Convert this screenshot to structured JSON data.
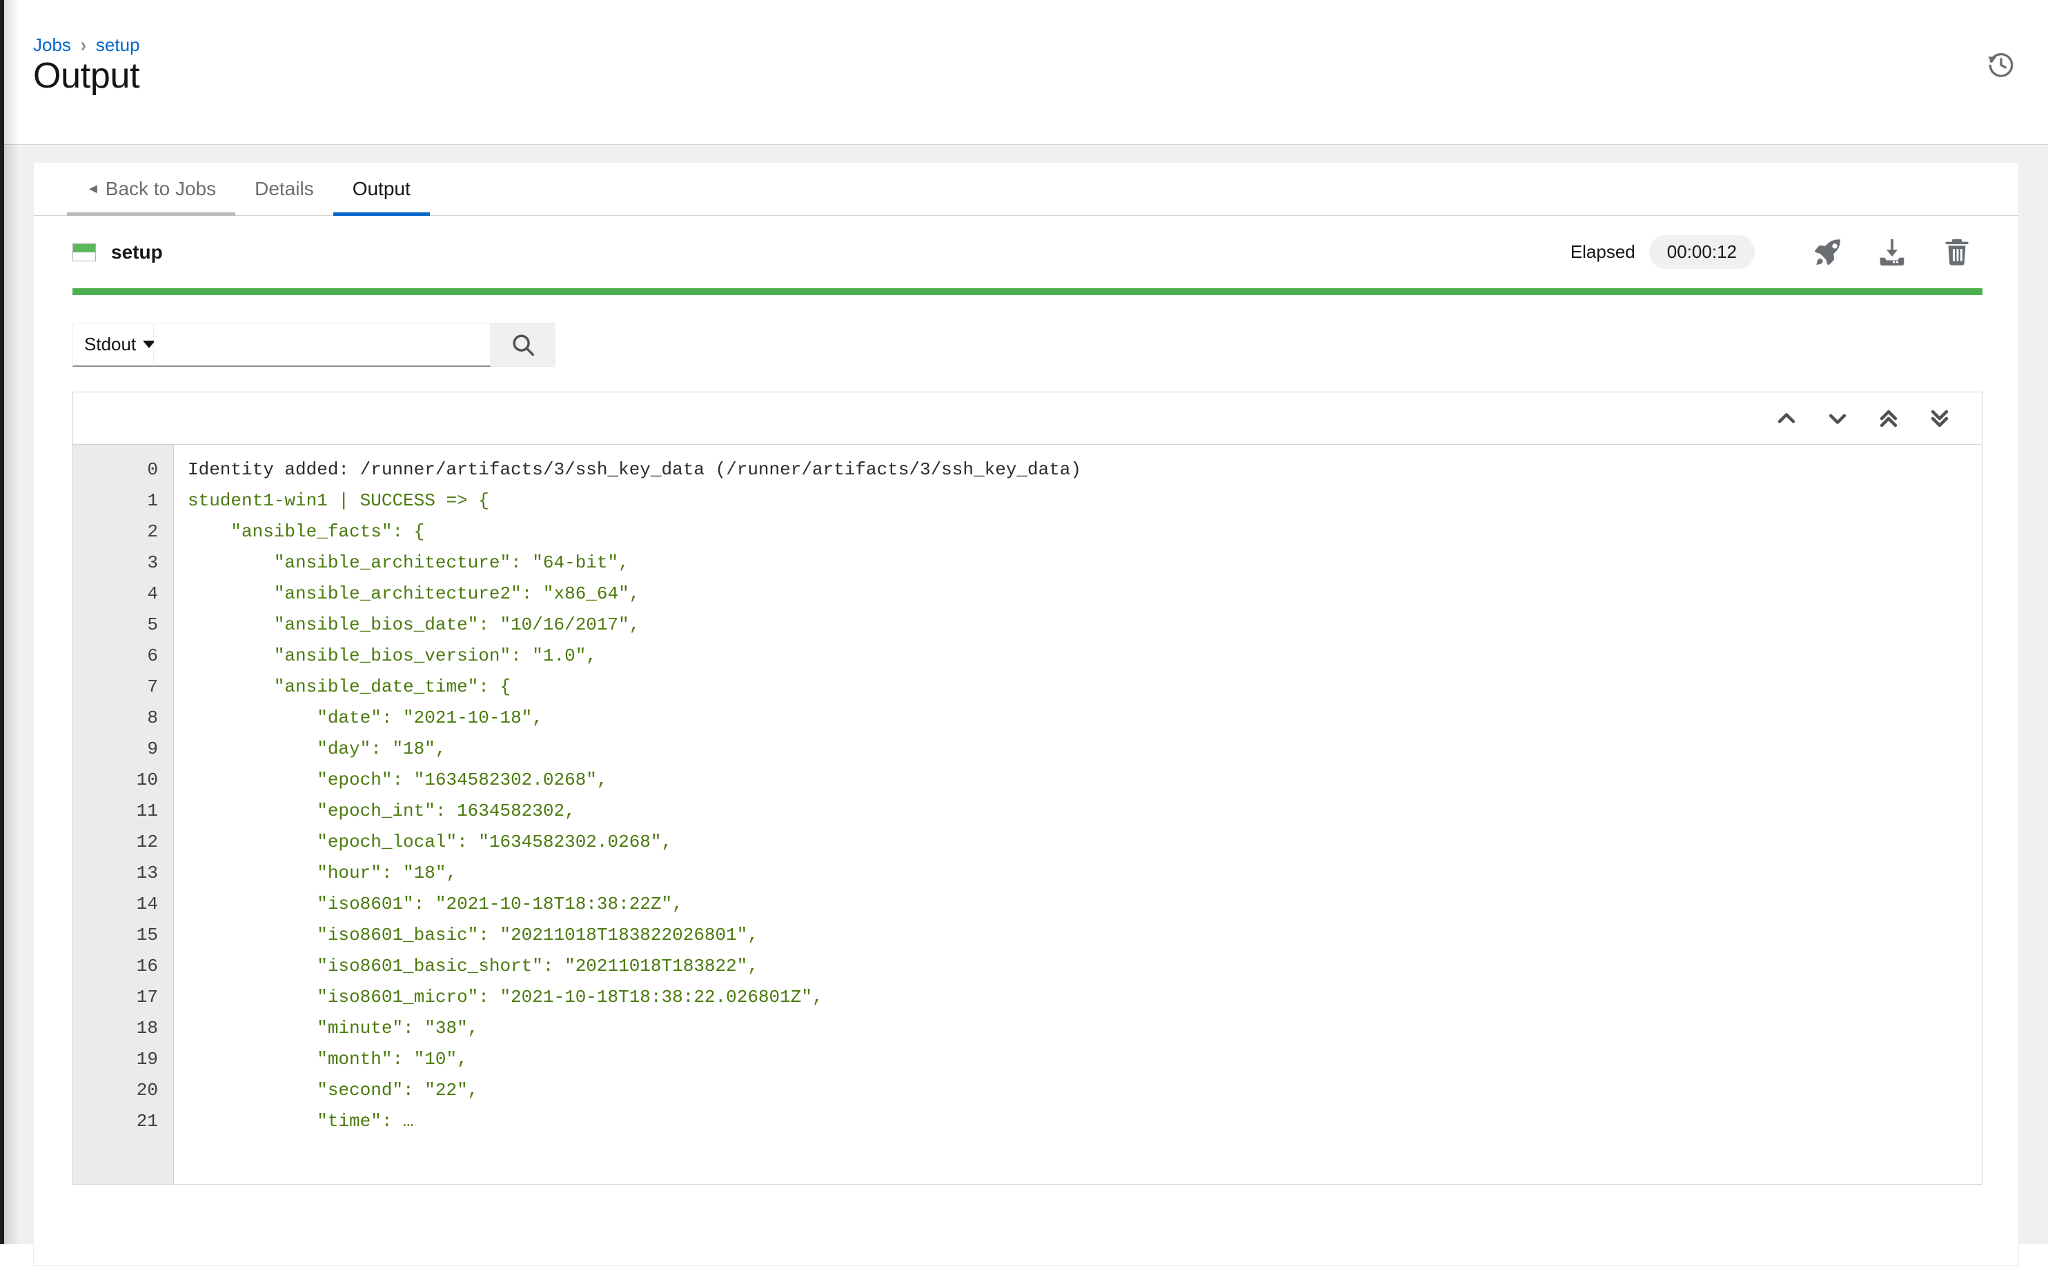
{
  "header": {
    "breadcrumb": {
      "root": "Jobs",
      "separator": "›",
      "current": "setup"
    },
    "title": "Output",
    "history_icon": "history-restore-icon"
  },
  "tabs": [
    {
      "label": "Back to Jobs",
      "name": "tab-back-to-jobs",
      "active": false,
      "back": true
    },
    {
      "label": "Details",
      "name": "tab-details",
      "active": false,
      "back": false
    },
    {
      "label": "Output",
      "name": "tab-output",
      "active": true,
      "back": false
    }
  ],
  "job": {
    "name": "setup",
    "status_icon": "job-status-success-icon",
    "elapsed_label": "Elapsed",
    "elapsed_value": "00:00:12",
    "actions": [
      {
        "name": "relaunch-job-button",
        "icon": "rocket-icon"
      },
      {
        "name": "download-output-button",
        "icon": "download-icon"
      },
      {
        "name": "delete-job-button",
        "icon": "trash-icon"
      }
    ],
    "progress_percent": 100,
    "progress_color": "#4caf50"
  },
  "search": {
    "select_value": "Stdout",
    "select_options": [
      "Stdout"
    ],
    "input_value": "",
    "input_placeholder": "",
    "search_button_icon": "search-icon"
  },
  "output_panel": {
    "nav_buttons": [
      {
        "name": "scroll-up-button",
        "icon": "chevron-up-icon",
        "glyph": "up"
      },
      {
        "name": "scroll-down-button",
        "icon": "chevron-down-icon",
        "glyph": "down"
      },
      {
        "name": "scroll-first-button",
        "icon": "chevron-double-up-icon",
        "glyph": "double-up"
      },
      {
        "name": "scroll-last-button",
        "icon": "chevron-double-down-icon",
        "glyph": "double-down"
      }
    ],
    "lines": [
      {
        "n": "0",
        "text": "Identity added: /runner/artifacts/3/ssh_key_data (/runner/artifacts/3/ssh_key_data)",
        "style": "plain"
      },
      {
        "n": "1",
        "text": "student1-win1 | SUCCESS => {",
        "style": "green"
      },
      {
        "n": "2",
        "text": "    \"ansible_facts\": {",
        "style": "green"
      },
      {
        "n": "3",
        "text": "        \"ansible_architecture\": \"64-bit\",",
        "style": "green"
      },
      {
        "n": "4",
        "text": "        \"ansible_architecture2\": \"x86_64\",",
        "style": "green"
      },
      {
        "n": "5",
        "text": "        \"ansible_bios_date\": \"10/16/2017\",",
        "style": "green"
      },
      {
        "n": "6",
        "text": "        \"ansible_bios_version\": \"1.0\",",
        "style": "green"
      },
      {
        "n": "7",
        "text": "        \"ansible_date_time\": {",
        "style": "green"
      },
      {
        "n": "8",
        "text": "            \"date\": \"2021-10-18\",",
        "style": "green"
      },
      {
        "n": "9",
        "text": "            \"day\": \"18\",",
        "style": "green"
      },
      {
        "n": "10",
        "text": "            \"epoch\": \"1634582302.0268\",",
        "style": "green"
      },
      {
        "n": "11",
        "text": "            \"epoch_int\": 1634582302,",
        "style": "green"
      },
      {
        "n": "12",
        "text": "            \"epoch_local\": \"1634582302.0268\",",
        "style": "green"
      },
      {
        "n": "13",
        "text": "            \"hour\": \"18\",",
        "style": "green"
      },
      {
        "n": "14",
        "text": "            \"iso8601\": \"2021-10-18T18:38:22Z\",",
        "style": "green"
      },
      {
        "n": "15",
        "text": "            \"iso8601_basic\": \"20211018T183822026801\",",
        "style": "green"
      },
      {
        "n": "16",
        "text": "            \"iso8601_basic_short\": \"20211018T183822\",",
        "style": "green"
      },
      {
        "n": "17",
        "text": "            \"iso8601_micro\": \"2021-10-18T18:38:22.026801Z\",",
        "style": "green"
      },
      {
        "n": "18",
        "text": "            \"minute\": \"38\",",
        "style": "green"
      },
      {
        "n": "19",
        "text": "            \"month\": \"10\",",
        "style": "green"
      },
      {
        "n": "20",
        "text": "            \"second\": \"22\",",
        "style": "green"
      },
      {
        "n": "21",
        "text": "            \"time\": …",
        "style": "green"
      }
    ]
  },
  "colors": {
    "link": "#0066cc",
    "active_tab": "#0066cc",
    "success_green": "#4caf50",
    "output_green": "#4a7a0d",
    "gutter_bg": "#ebebeb",
    "page_bg": "#f0f0f0"
  }
}
